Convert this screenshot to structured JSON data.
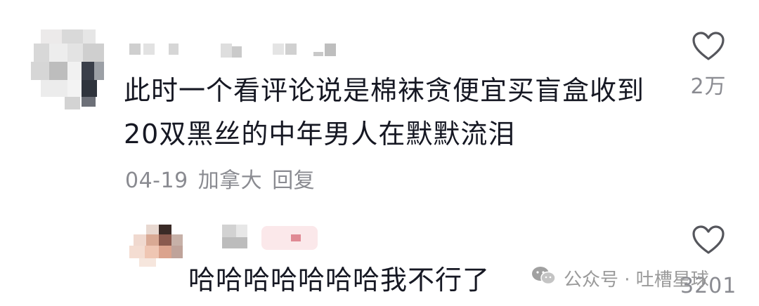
{
  "comments": [
    {
      "text": "此时一个看评论说是棉袜贪便宜买盲盒收到\n20双黑丝的中年男人在默默流泪",
      "date": "04-19",
      "location": "加拿大",
      "reply_label": "回复",
      "likes": "2万",
      "icon": "heart-outline-icon"
    },
    {
      "text": "哈哈哈哈哈哈哈我不行了",
      "likes": "3201",
      "icon": "heart-outline-icon"
    }
  ],
  "watermark": {
    "text": "公众号 · 吐槽星球",
    "icon": "wechat-icon"
  }
}
